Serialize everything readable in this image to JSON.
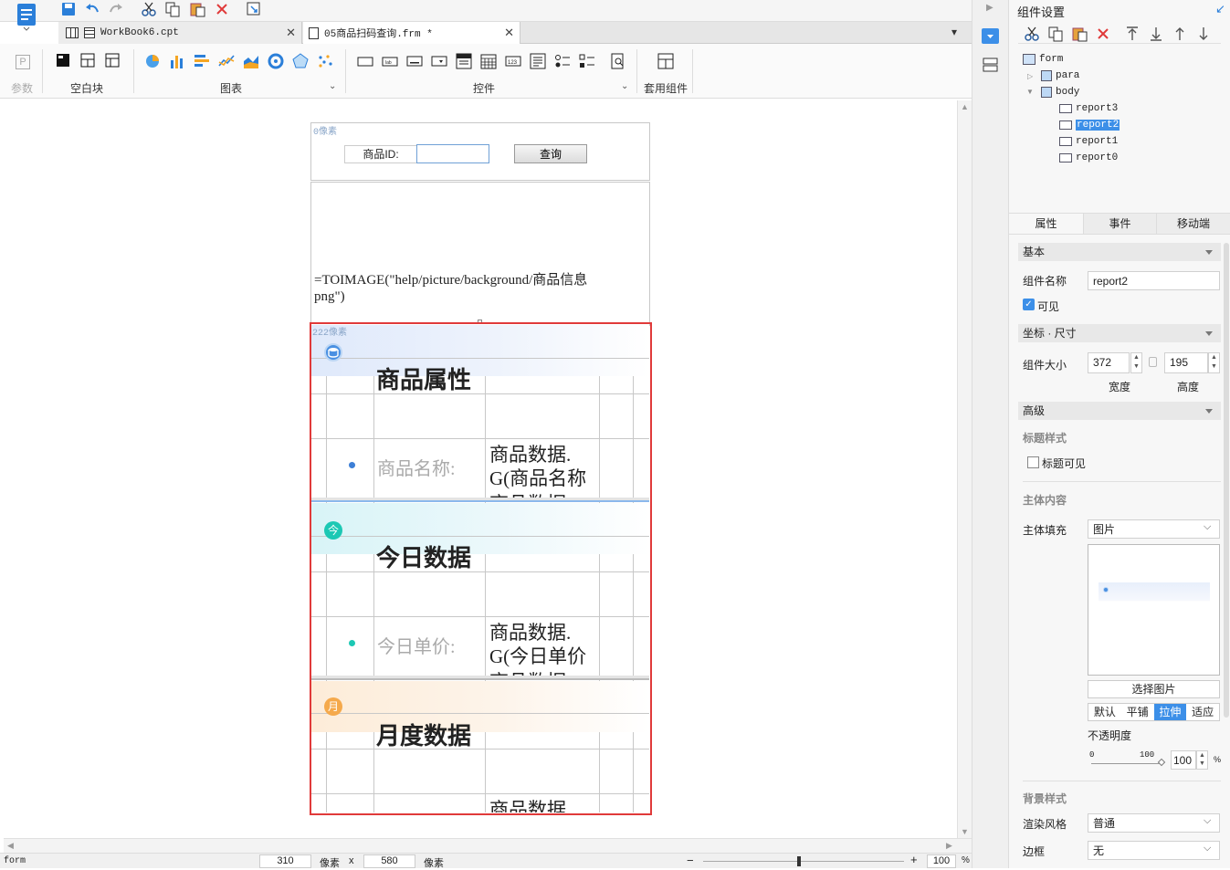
{
  "tabs": [
    {
      "label": "WorkBook6.cpt",
      "active": false
    },
    {
      "label": "05商品扫码查询.frm *",
      "active": true
    }
  ],
  "ribbon": {
    "param_label": "参数",
    "blank_label": "空白块",
    "chart_label": "图表",
    "control_label": "控件",
    "suite_label": "套用组件"
  },
  "canvas": {
    "top_pixel_label": "0像素",
    "product_id_label": "商品ID:",
    "product_id_value": "",
    "query_button": "查询",
    "formula_line1": "=TOIMAGE(\"help/picture/background/商品信息",
    "formula_line2": "png\")",
    "mid_pixel_label": "222像素",
    "section1_icon": "",
    "section1_title": "商品属性",
    "section1_field": "商品名称:",
    "section1_value1": "商品数据.",
    "section1_value2": "G(商品名称",
    "section1_value3": "商品数据",
    "section2_icon": "今",
    "section2_title": "今日数据",
    "section2_field": "今日单价:",
    "section2_value1": "商品数据.",
    "section2_value2": "G(今日单价",
    "section2_value3": "商品数据",
    "section3_icon": "月",
    "section3_title": "月度数据",
    "section3_value1": "商品数据."
  },
  "status": {
    "context": "form",
    "width_value": "310",
    "width_unit": "像素",
    "x_sep": "x",
    "height_value": "580",
    "height_unit": "像素",
    "zoom_value": "100",
    "zoom_unit": "%"
  },
  "right_panel": {
    "title": "组件设置",
    "tree": [
      {
        "label": "form",
        "level": 0
      },
      {
        "label": "para",
        "level": 1
      },
      {
        "label": "body",
        "level": 1
      },
      {
        "label": "report3",
        "level": 2
      },
      {
        "label": "report2",
        "level": 2,
        "selected": true
      },
      {
        "label": "report1",
        "level": 2
      },
      {
        "label": "report0",
        "level": 2
      }
    ],
    "tabs": [
      "属性",
      "事件",
      "移动端"
    ],
    "sections": {
      "basic": "基本",
      "coord": "坐标 · 尺寸",
      "advanced": "高级"
    },
    "component_name_label": "组件名称",
    "component_name_value": "report2",
    "visible_label": "可见",
    "size_label": "组件大小",
    "width_value": "372",
    "height_value": "195",
    "width_label": "宽度",
    "height_label": "高度",
    "title_style_label": "标题样式",
    "title_visible_label": "标题可见",
    "body_content_label": "主体内容",
    "body_fill_label": "主体填充",
    "body_fill_value": "图片",
    "select_image_button": "选择图片",
    "fill_modes": [
      "默认",
      "平铺",
      "拉伸",
      "适应"
    ],
    "fill_mode_active": "拉伸",
    "opacity_label": "不透明度",
    "slider_min": "0",
    "slider_max": "100",
    "opacity_value": "100",
    "opacity_unit": "%",
    "bg_style_label": "背景样式",
    "render_style_label": "渲染风格",
    "render_style_value": "普通",
    "border_label": "边框",
    "border_value": "无"
  },
  "colors": {
    "accent": "#2b7fd9",
    "selection_red": "#e03a3a",
    "active_blue": "#3c8fe8"
  }
}
